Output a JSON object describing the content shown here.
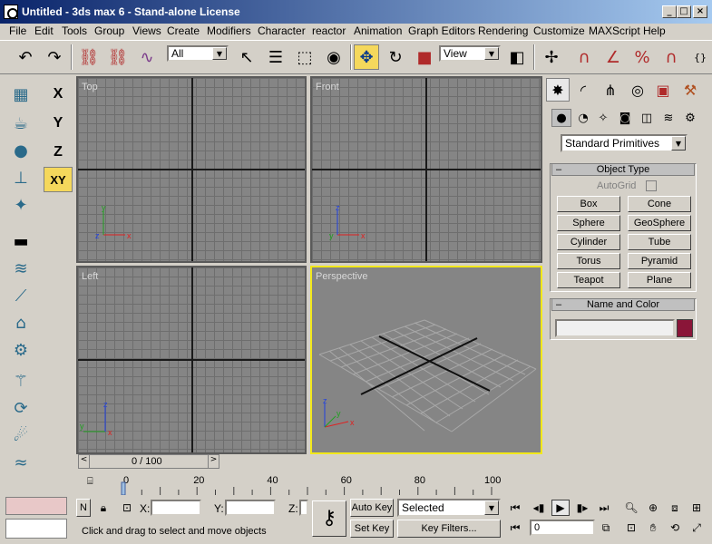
{
  "window": {
    "title": "Untitled - 3ds max 6 - Stand-alone License"
  },
  "menu": [
    "File",
    "Edit",
    "Tools",
    "Group",
    "Views",
    "Create",
    "Modifiers",
    "Character",
    "reactor",
    "Animation",
    "Graph Editors",
    "Rendering",
    "Customize",
    "MAXScript",
    "Help"
  ],
  "toolbar": {
    "selection_filter": "All",
    "reference_coord": "View"
  },
  "axis": {
    "x": "X",
    "y": "Y",
    "z": "Z",
    "xy": "XY"
  },
  "viewports": [
    {
      "label": "Top"
    },
    {
      "label": "Front"
    },
    {
      "label": "Left"
    },
    {
      "label": "Perspective"
    }
  ],
  "gizmo": {
    "x": "x",
    "y": "y",
    "z": "z"
  },
  "command_panel": {
    "category": "Standard Primitives",
    "object_type_title": "Object Type",
    "autogrid": "AutoGrid",
    "buttons": [
      "Box",
      "Cone",
      "Sphere",
      "GeoSphere",
      "Cylinder",
      "Tube",
      "Torus",
      "Pyramid",
      "Teapot",
      "Plane"
    ],
    "name_color_title": "Name and Color",
    "object_name": "",
    "object_color": "#8a1538"
  },
  "timeline": {
    "slider_label": "0 / 100",
    "ticks": [
      "0",
      "20",
      "40",
      "60",
      "80",
      "100"
    ],
    "slider_value": 0,
    "slider_max": 100
  },
  "status": {
    "x_label": "X:",
    "y_label": "Y:",
    "z_label": "Z:",
    "x_value": "",
    "y_value": "",
    "z_value": "",
    "auto_key": "Auto Key",
    "set_key": "Set Key",
    "key_mode": "Selected",
    "key_filters": "Key Filters...",
    "frame": "0",
    "prompt": "Click and drag to select and move objects",
    "lock_label": "N"
  },
  "colors": {
    "active_button": "#f5d85c",
    "active_viewport": "#f2e81a",
    "titlebar": "#0a246a"
  }
}
